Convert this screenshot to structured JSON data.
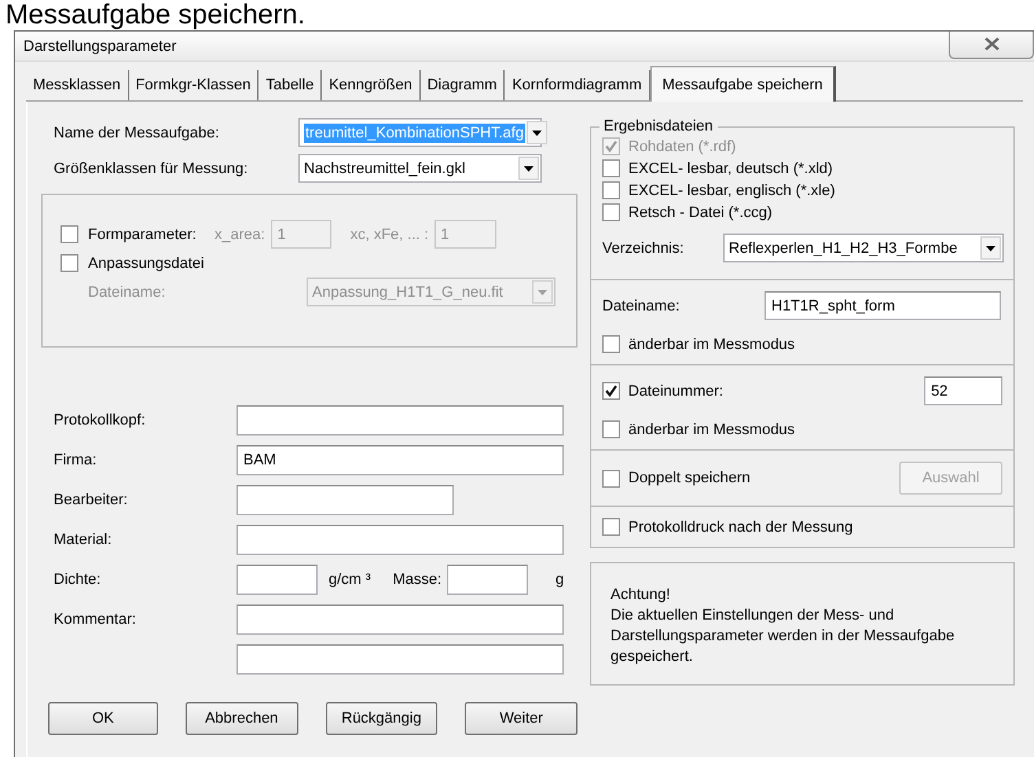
{
  "caption": "Messaufgabe speichern.",
  "window": {
    "title": "Darstellungsparameter"
  },
  "tabs": [
    {
      "label": "Messklassen",
      "selected": false
    },
    {
      "label": "Formkgr-Klassen",
      "selected": false
    },
    {
      "label": "Tabelle",
      "selected": false
    },
    {
      "label": "Kenngrößen",
      "selected": false
    },
    {
      "label": "Diagramm",
      "selected": false
    },
    {
      "label": "Kornformdiagramm",
      "selected": false
    },
    {
      "label": "Messaufgabe speichern",
      "selected": true
    }
  ],
  "task": {
    "name": {
      "label": "Name der Messaufgabe:",
      "value": "treumittel_KombinationSPHT.afg",
      "text_selected": true
    },
    "size_classes": {
      "label": "Größenklassen für Messung:",
      "value": "Nachstreumittel_fein.gkl",
      "text_selected": false
    }
  },
  "shape_group": {
    "form_parameter": {
      "label": "Formparameter:",
      "checked": false
    },
    "x_area": {
      "label": "x_area:",
      "value": "1",
      "disabled": true
    },
    "xc": {
      "label": "xc, xFe, ... :",
      "value": "1",
      "disabled": true
    },
    "fit_file": {
      "label": "Anpassungsdatei",
      "checked": false
    },
    "file_name": {
      "label": "Dateiname:",
      "value": "Anpassung_H1T1_G_neu.fit",
      "disabled": true
    }
  },
  "protocol": [
    {
      "kind": "wide",
      "label": "Protokollkopf:"
    },
    {
      "kind": "wide",
      "label": "Firma:",
      "value": "BAM"
    },
    {
      "kind": "short",
      "label": "Bearbeiter:"
    },
    {
      "kind": "wide",
      "label": "Material:"
    },
    {
      "kind": "density",
      "label": "Dichte:",
      "unit": "g/cm ³",
      "mass_label": "Masse:",
      "mass_unit": "g"
    },
    {
      "kind": "wide",
      "label": "Kommentar:"
    },
    {
      "kind": "wide"
    }
  ],
  "results": {
    "title": "Ergebnisdateien",
    "files": [
      {
        "label": "Rohdaten (*.rdf)",
        "checked": true,
        "disabled": true
      },
      {
        "label": "EXCEL- lesbar, deutsch (*.xld)",
        "checked": false,
        "disabled": false
      },
      {
        "label": "EXCEL- lesbar, englisch (*.xle)",
        "checked": false,
        "disabled": false
      },
      {
        "label": "Retsch - Datei (*.ccg)",
        "checked": false,
        "disabled": false
      }
    ],
    "directory": {
      "label": "Verzeichnis:",
      "value": "Reflexperlen_H1_H2_H3_Formbe"
    }
  },
  "file_name": {
    "label": "Dateiname:",
    "value": "H1T1R_spht_form",
    "changeable": {
      "label": "änderbar im Messmodus",
      "checked": false
    }
  },
  "file_number": {
    "label": "Dateinummer:",
    "checked": true,
    "value": "52",
    "changeable": {
      "label": "änderbar im Messmodus",
      "checked": false
    }
  },
  "double_save": {
    "label": "Doppelt speichern",
    "checked": false,
    "button": {
      "label": "Auswahl",
      "disabled": true
    }
  },
  "print_protocol": {
    "label": "Protokolldruck nach der Messung",
    "checked": false
  },
  "notice": {
    "title": "Achtung!",
    "text": "Die aktuellen Einstellungen der Mess- und Darstellungsparameter werden in der Messaufgabe gespeichert."
  },
  "buttons": [
    "OK",
    "Abbrechen",
    "Rückgängig",
    "Weiter"
  ]
}
